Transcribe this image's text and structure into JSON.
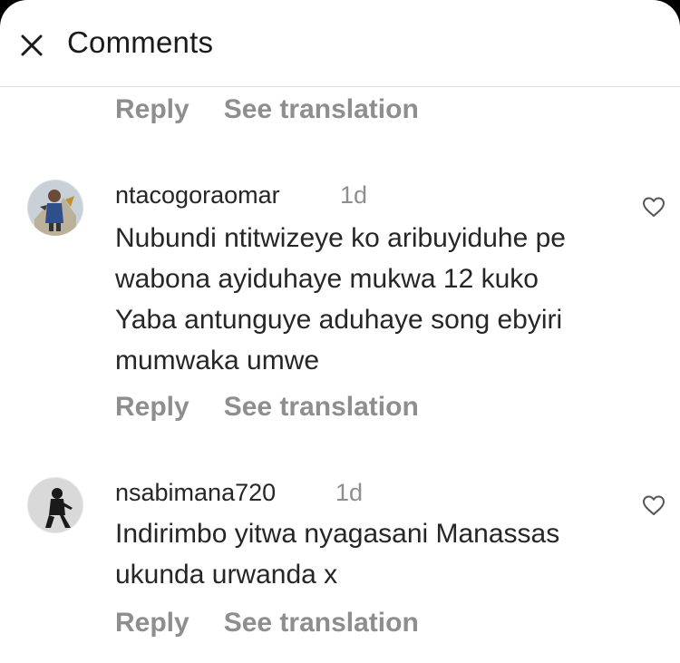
{
  "header": {
    "title": "Comments",
    "close_icon": "close-icon"
  },
  "top_actions": {
    "reply": "Reply",
    "see_translation": "See translation"
  },
  "comments": [
    {
      "username": "ntacogoraomar",
      "time": "1d",
      "lines": [
        "Nubundi ntitwizeye ko aribuyiduhe pe",
        "wabona ayiduhaye mukwa 12 kuko",
        "Yaba antunguye aduhaye song ebyiri",
        "mumwaka umwe"
      ],
      "reply": "Reply",
      "see_translation": "See translation"
    },
    {
      "username": "nsabimana720",
      "time": "1d",
      "lines": [
        "Indirimbo yitwa nyagasani Manassas",
        "ukunda urwanda x"
      ],
      "reply": "Reply",
      "see_translation": "See translation"
    }
  ],
  "colors": {
    "text": "#262626",
    "secondary": "#8e8e8e",
    "divider": "#dcdcdc"
  }
}
